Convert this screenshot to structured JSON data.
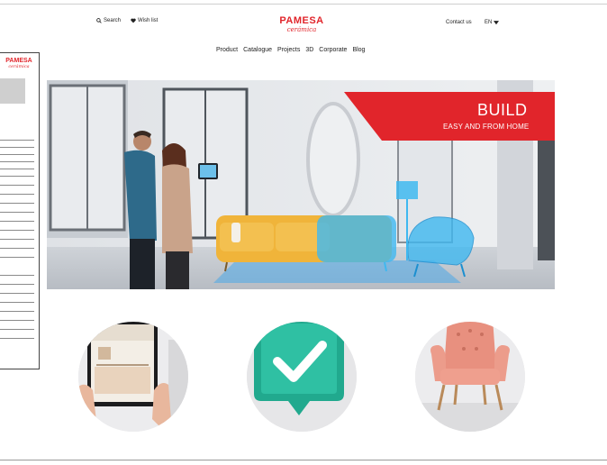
{
  "header": {
    "search_label": "Search",
    "wishlist_label": "Wish list",
    "logo_main": "PAMESA",
    "logo_sub": "cerámica",
    "contact_label": "Contact us",
    "language": "EN"
  },
  "nav": {
    "items": [
      "Product",
      "Catalogue",
      "Projects",
      "3D",
      "Corporate",
      "Blog"
    ]
  },
  "hero": {
    "title": "BUILD",
    "subtitle": "EASY AND FROM HOME"
  },
  "document": {
    "logo_main": "PAMESA",
    "logo_sub": "cerámica"
  },
  "colors": {
    "brand_red": "#e1252b",
    "sofa_yellow": "#f0b43a",
    "hologram_blue": "#3fb8f0",
    "check_teal": "#2fb39a",
    "armchair_pink": "#e8907f"
  },
  "icons": [
    "search-icon",
    "heart-icon",
    "chevron-down-icon",
    "tablet-kitchen-icon",
    "checkmark-badge-icon",
    "armchair-icon"
  ]
}
